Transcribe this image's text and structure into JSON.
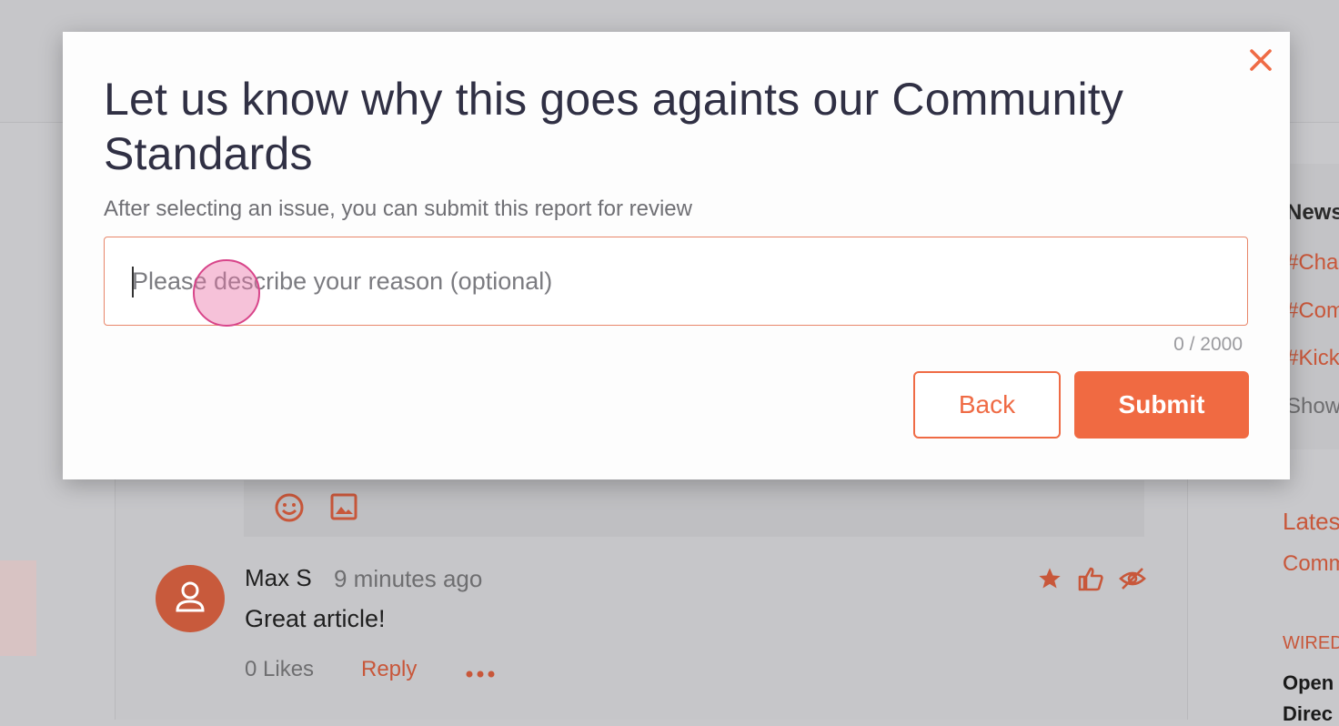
{
  "modal": {
    "title": "Let us know why this goes againts our Community Standards",
    "subtitle": "After selecting an issue, you can submit this report for review",
    "reason_placeholder": "Please describe your reason (optional)",
    "reason_value": "",
    "char_count": "0 / 2000",
    "back_label": "Back",
    "submit_label": "Submit",
    "close_icon": "close-icon"
  },
  "comment": {
    "author": "Max S",
    "time": "9 minutes ago",
    "body": "Great article!",
    "likes": "0 Likes",
    "reply": "Reply"
  },
  "sidebar": {
    "news_title": "News",
    "tags": [
      "#Cha",
      "#Com",
      "#Kick"
    ],
    "show_more": "Show",
    "latest_title": "Lates",
    "latest_sub": "Comm",
    "source": "WIRED",
    "headline_line1": "Open",
    "headline_line2": "Direc"
  },
  "colors": {
    "accent": "#f06a42",
    "title": "#303044",
    "backdrop": "#c8c8cb"
  }
}
